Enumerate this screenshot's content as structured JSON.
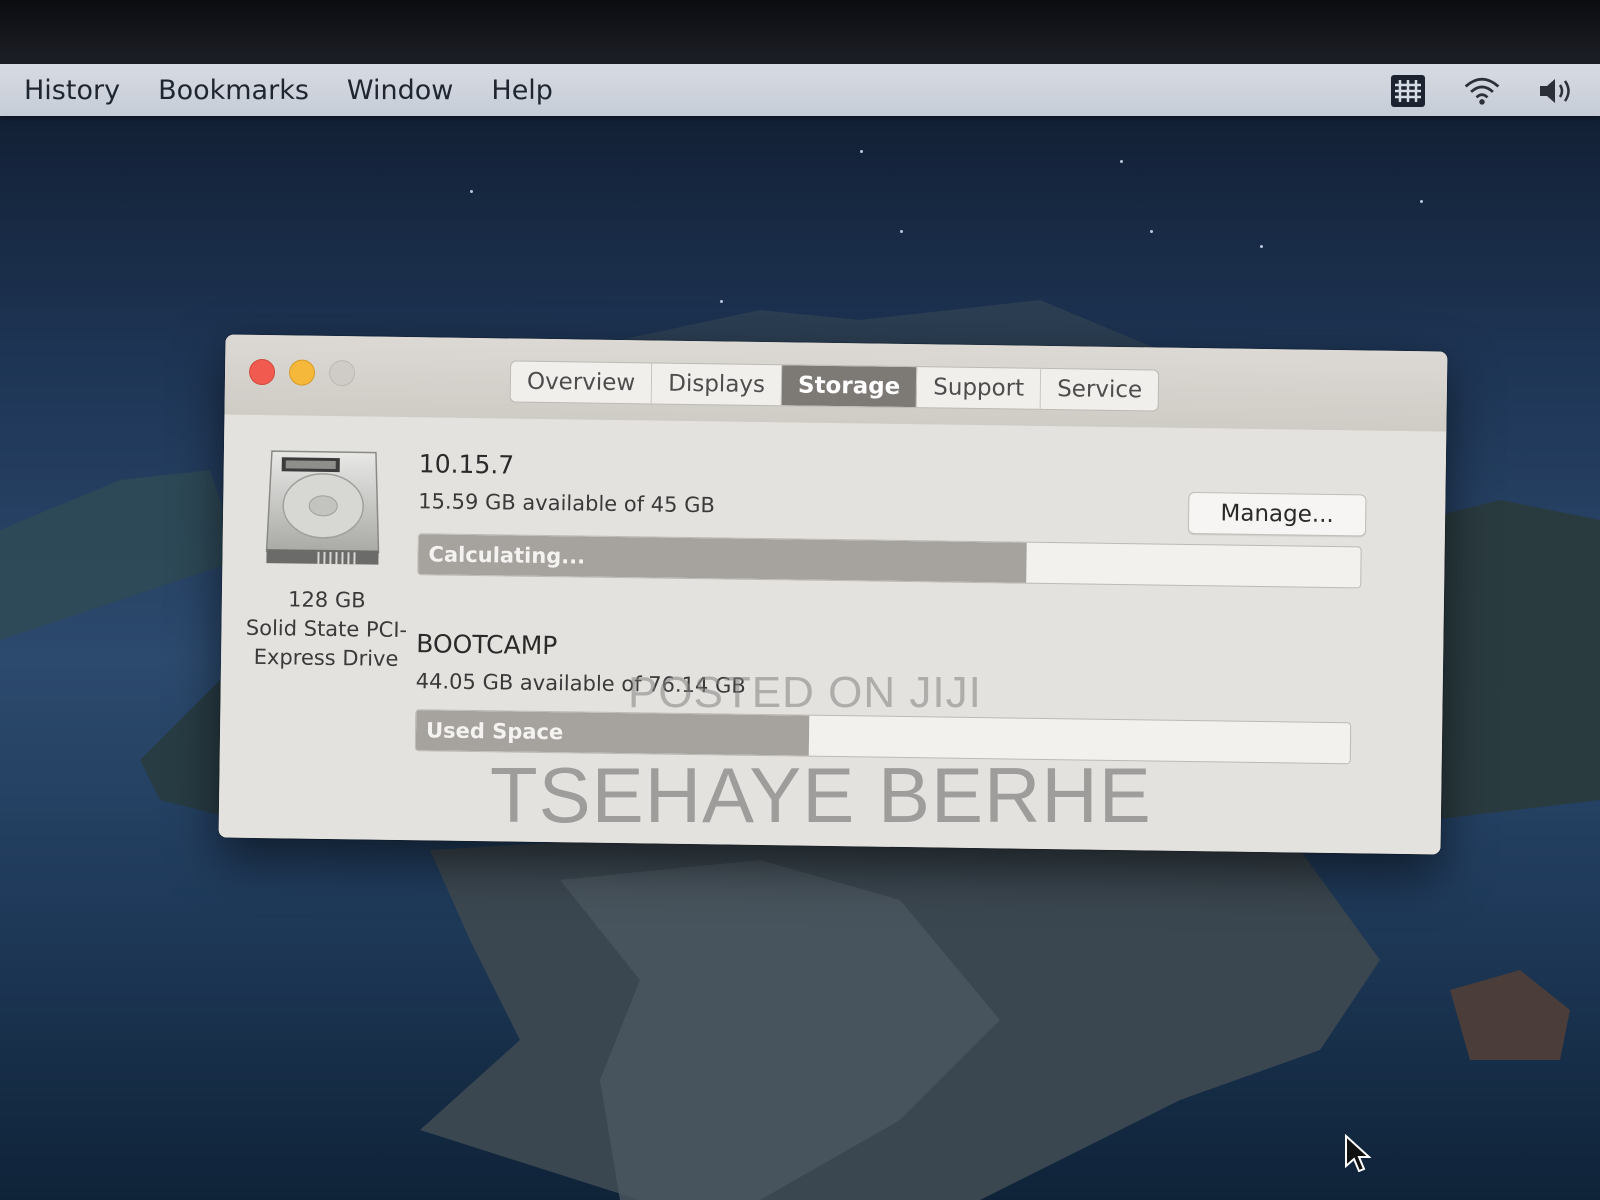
{
  "menubar": {
    "items": [
      "History",
      "Bookmarks",
      "Window",
      "Help"
    ],
    "status_icons": [
      "input-source-icon",
      "wifi-icon",
      "volume-icon"
    ]
  },
  "window": {
    "tabs": [
      "Overview",
      "Displays",
      "Storage",
      "Support",
      "Service"
    ],
    "active_tab": "Storage",
    "drive": {
      "capacity": "128 GB",
      "type_line1": "Solid State PCI-",
      "type_line2": "Express Drive"
    },
    "volumes": [
      {
        "name": "10.15.7",
        "available": "15.59 GB available of 45 GB",
        "bar_label": "Calculating...",
        "used_fraction": 0.645
      },
      {
        "name": "BOOTCAMP",
        "available": "44.05 GB available of 76.14 GB",
        "bar_label": "Used Space",
        "used_fraction": 0.421
      }
    ],
    "manage_label": "Manage..."
  },
  "watermark": {
    "line1": "POSTED ON JIJI",
    "line2": "TSEHAYE BERHE"
  },
  "colors": {
    "close": "#f05a4f",
    "minimize": "#f5b83a",
    "active_tab": "#7d7a76",
    "bar_fill": "#a6a39f"
  }
}
